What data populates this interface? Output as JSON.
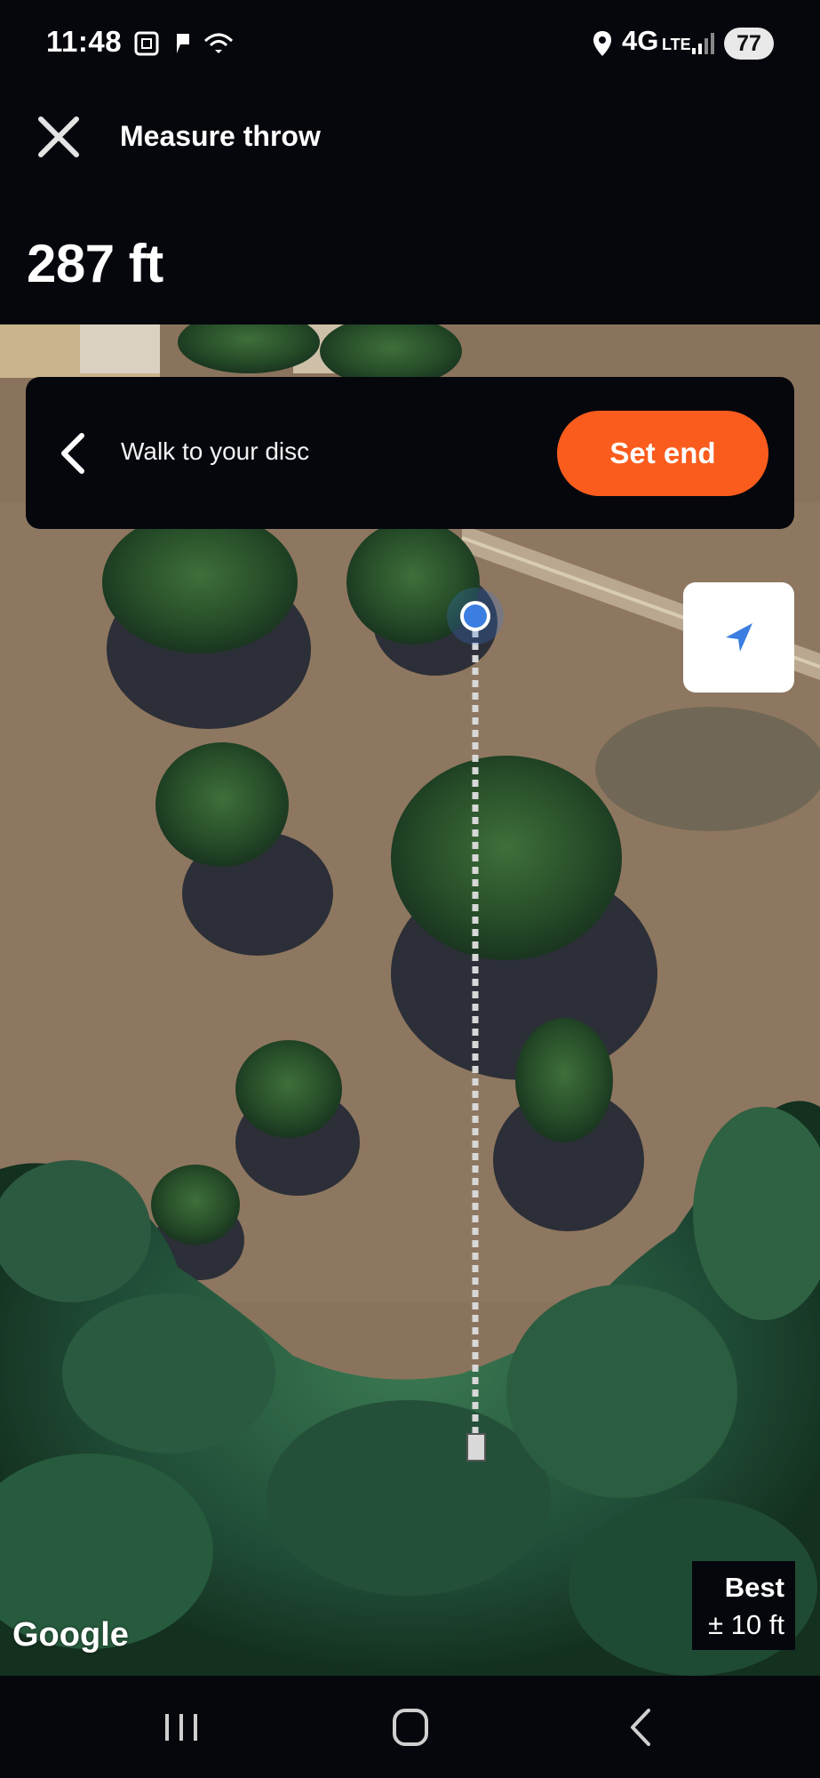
{
  "status_bar": {
    "time": "11:48",
    "network": "4G",
    "network_sub": "LTE",
    "battery": "77",
    "icons": [
      "screenshot-icon",
      "notification-flag-icon",
      "wifi-icon",
      "location-pin-icon",
      "signal-icon"
    ]
  },
  "header": {
    "close_icon": "close-icon",
    "title": "Measure throw",
    "distance": "287 ft"
  },
  "instruction": {
    "back_icon": "chevron-left-icon",
    "text": "Walk to your disc",
    "button_label": "Set end",
    "button_color": "#fa5c1d"
  },
  "map": {
    "type": "satellite",
    "attribution": "Google",
    "accuracy_label": "Best",
    "accuracy_value": "± 10 ft",
    "current_location_color": "#3b7de0",
    "locate_icon": "navigation-arrow-icon"
  },
  "nav_bar": {
    "icons": [
      "recent-apps-icon",
      "home-icon",
      "back-icon"
    ]
  }
}
